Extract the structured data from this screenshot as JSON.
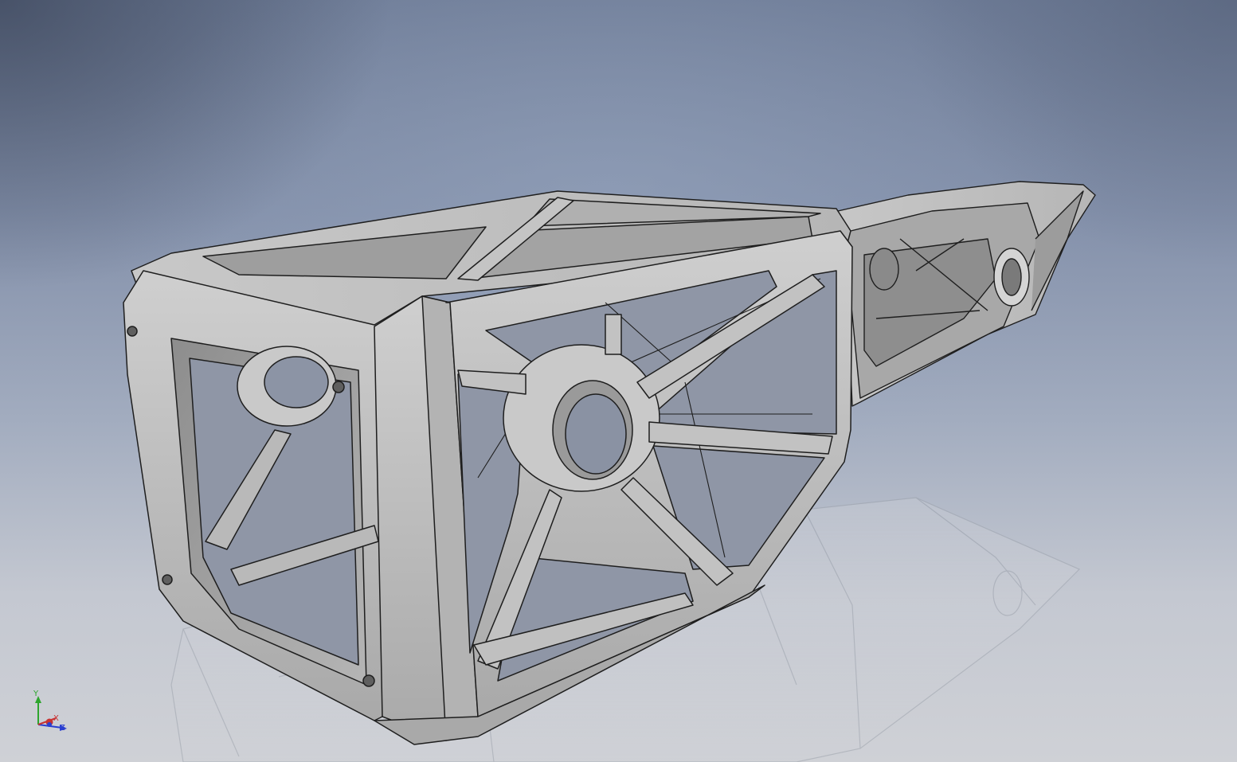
{
  "viewer": {
    "background_top": "#6f7d98",
    "background_bottom": "#cfd1d6",
    "model_color": "#bdbdbd",
    "edge_color": "#1e1e1e"
  },
  "model": {
    "icon": "frame-part-3d-model",
    "style": "shaded-with-edges"
  },
  "reflection": {
    "visible": true
  },
  "view_triad": {
    "axes": [
      {
        "label": "Y",
        "color": "#2da52d"
      },
      {
        "label": "X",
        "color": "#c83232"
      },
      {
        "label": "Z",
        "color": "#2a3fd0"
      }
    ]
  }
}
